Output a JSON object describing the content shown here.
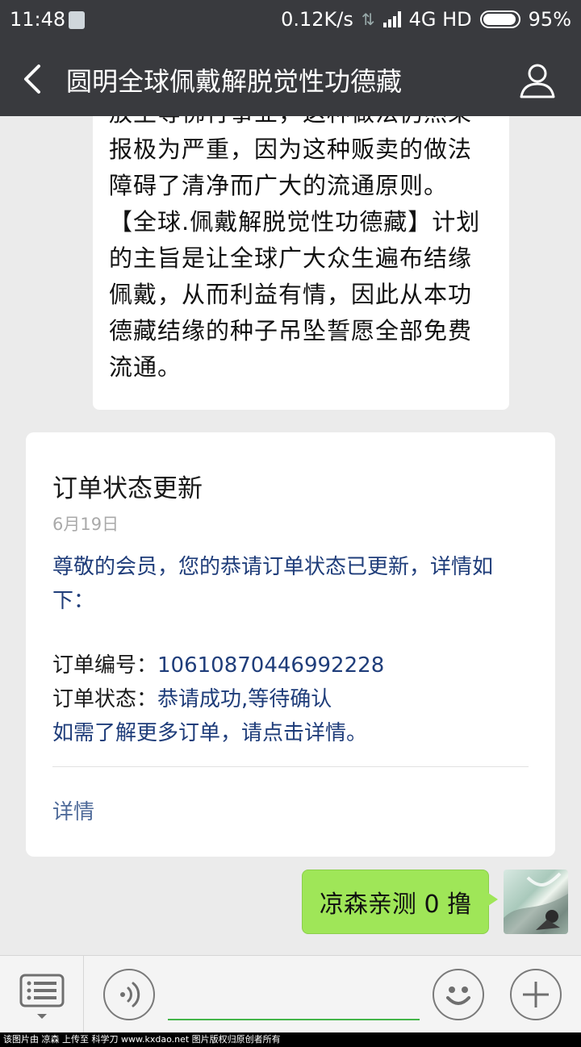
{
  "status_bar": {
    "time": "11:48",
    "network_speed": "0.12K/s",
    "network_type": "4G HD",
    "battery": "95%",
    "battery_level": 0.95
  },
  "nav": {
    "back_icon": "chevron-left-icon",
    "title": "圆明全球佩戴解脱觉性功德藏",
    "profile_icon": "person-icon"
  },
  "messages": {
    "incoming_text": {
      "lines": [
        "放生等佛行事业，这种做法仍然果",
        "报极为严重，因为这种贩卖的做法",
        "障碍了清净而广大的流通原则。",
        "【全球.佩戴解脱觉性功德藏】计划",
        "的主旨是让全球广大众生遍布结缘",
        "佩戴，从而利益有情，因此从本功",
        "德藏结缘的种子吊坠誓愿全部免费",
        "流通。"
      ]
    },
    "order_card": {
      "title": "订单状态更新",
      "date": "6月19日",
      "intro": "尊敬的会员，您的恭请订单状态已更新，详情如下：",
      "order_no_label": "订单编号：",
      "order_no_value": "10610870446992228",
      "order_status_label": "订单状态：",
      "order_status_value": "恭请成功,等待确认",
      "note": "如需了解更多订单，请点击详情。",
      "detail_link": "详情"
    },
    "outgoing_text": "凉森亲测 0 撸"
  },
  "input_bar": {
    "menu_icon": "keyboard-menu-icon",
    "voice_icon": "voice-icon",
    "emoji_icon": "emoji-icon",
    "plus_icon": "plus-icon",
    "accent_color": "#43b548"
  },
  "footer": {
    "watermark": "该图片由 凉森 上传至 科学刀 www.kxdao.net 图片版权归原创者所有"
  },
  "colors": {
    "header_bg": "#393a3e",
    "chat_bg": "#ebebeb",
    "bubble_out": "#9fe658",
    "link_blue": "#1f3d7a"
  }
}
